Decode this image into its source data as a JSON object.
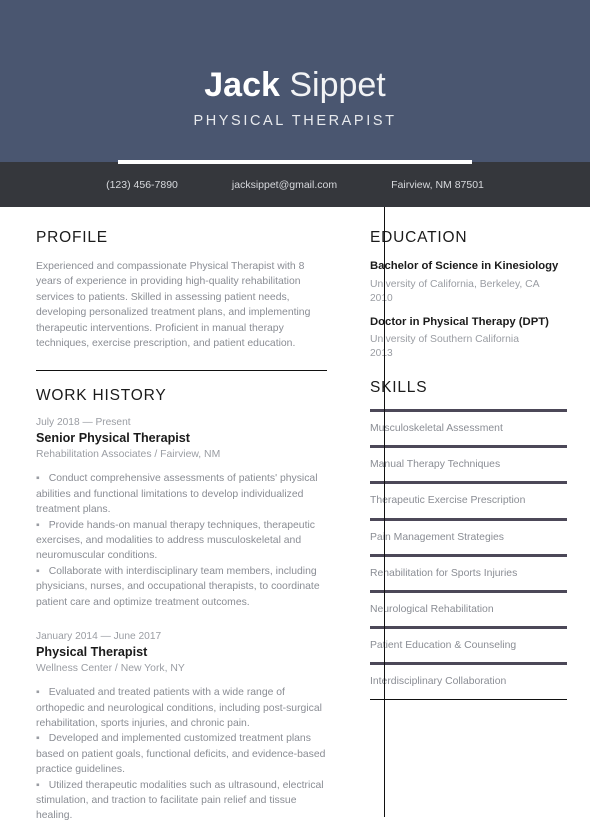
{
  "header": {
    "first_name": "Jack",
    "last_name": "Sippet",
    "job_title": "PHYSICAL THERAPIST",
    "bg_color": "#4a5670",
    "contact_bar_color": "#35373c"
  },
  "contact": {
    "phone": "(123) 456-7890",
    "email": "jacksippet@gmail.com",
    "location": "Fairview, NM 87501"
  },
  "profile": {
    "heading": "PROFILE",
    "text": "Experienced and compassionate Physical Therapist with 8 years of experience in providing high-quality rehabilitation services to patients. Skilled in assessing patient needs, developing personalized treatment plans, and implementing therapeutic interventions. Proficient in manual therapy techniques, exercise prescription, and patient education."
  },
  "work_history": {
    "heading": "WORK HISTORY",
    "jobs": [
      {
        "date": "July 2018 — Present",
        "role": "Senior Physical Therapist",
        "company": "Rehabilitation Associates / Fairview, NM",
        "bullets": [
          "Conduct comprehensive assessments of patients' physical abilities and functional limitations to develop individualized treatment plans.",
          "Provide hands-on manual therapy techniques, therapeutic exercises, and modalities to address musculoskeletal and neuromuscular conditions.",
          "Collaborate with interdisciplinary team members, including physicians, nurses, and occupational therapists, to coordinate patient care and optimize treatment outcomes."
        ]
      },
      {
        "date": "January 2014 — June 2017",
        "role": "Physical Therapist",
        "company": "Wellness Center / New York, NY",
        "bullets": [
          "Evaluated and treated patients with a wide range of orthopedic and neurological conditions, including post-surgical rehabilitation, sports injuries, and chronic pain.",
          "Developed and implemented customized treatment plans based on patient goals, functional deficits, and evidence-based practice guidelines.",
          "Utilized therapeutic modalities such as ultrasound, electrical stimulation, and traction to facilitate pain relief and tissue healing."
        ]
      }
    ]
  },
  "education": {
    "heading": "EDUCATION",
    "items": [
      {
        "degree": "Bachelor of Science in Kinesiology",
        "school": "University of California, Berkeley, CA",
        "year": "2010"
      },
      {
        "degree": "Doctor in Physical Therapy (DPT)",
        "school": "University of Southern California",
        "year": "2013"
      }
    ]
  },
  "skills": {
    "heading": "SKILLS",
    "bar_color": "#4c4858",
    "items": [
      "Musculoskeletal Assessment",
      "Manual Therapy Techniques",
      "Therapeutic Exercise Prescription",
      "Pain Management Strategies",
      "Rehabilitation for Sports Injuries",
      "Neurological Rehabilitation",
      "Patient Education & Counseling",
      "Interdisciplinary Collaboration"
    ]
  },
  "bullet_glyph": "▪"
}
